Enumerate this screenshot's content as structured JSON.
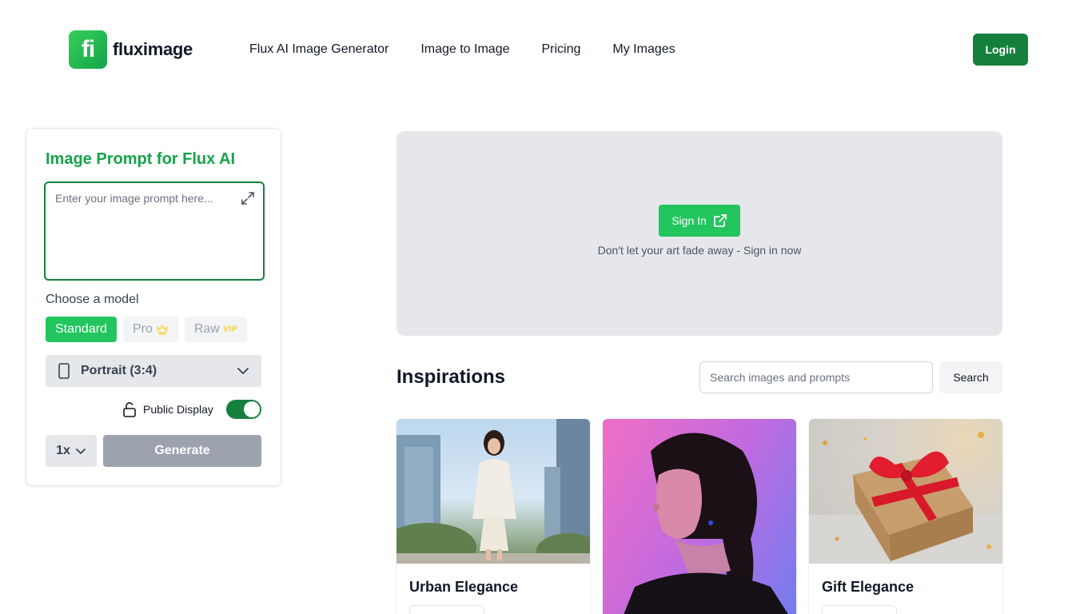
{
  "brand": {
    "mark": "fi",
    "name": "fluximage",
    "accent": "#16a34a"
  },
  "nav": [
    {
      "label": "Flux AI Image Generator"
    },
    {
      "label": "Image to Image"
    },
    {
      "label": "Pricing"
    },
    {
      "label": "My Images"
    }
  ],
  "header": {
    "login_label": "Login"
  },
  "generator": {
    "title": "Image Prompt for Flux AI",
    "prompt_placeholder": "Enter your image prompt here...",
    "prompt_value": "",
    "model_label": "Choose a model",
    "models": [
      {
        "label": "Standard",
        "active": true
      },
      {
        "label": "Pro",
        "badge_icon": "crown-icon"
      },
      {
        "label": "Raw",
        "badge": "VIP"
      }
    ],
    "aspect_ratio": "Portrait (3:4)",
    "public_display_label": "Public Display",
    "public_display_on": true,
    "quantity": "1x",
    "generate_label": "Generate"
  },
  "signin": {
    "button_label": "Sign In",
    "subtitle": "Don't let your art fade away - Sign in now"
  },
  "inspirations": {
    "title": "Inspirations",
    "search_placeholder": "Search images and prompts",
    "search_label": "Search",
    "cards": [
      {
        "title": "Urban Elegance"
      },
      {
        "title": ""
      },
      {
        "title": "Gift Elegance"
      }
    ]
  }
}
